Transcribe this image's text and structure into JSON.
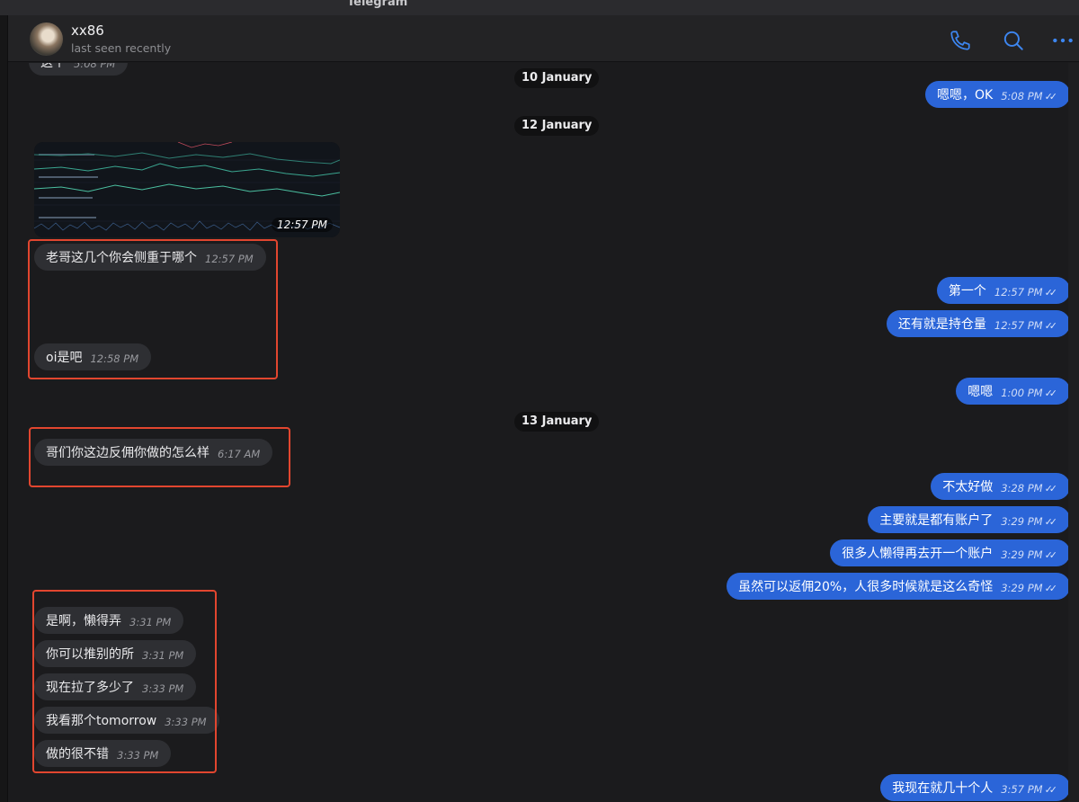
{
  "window": {
    "title": "Telegram"
  },
  "header": {
    "contact_name": "xx86",
    "contact_status": "last seen recently",
    "icons": [
      "phone-icon",
      "search-icon",
      "more-icon"
    ]
  },
  "chat": {
    "dates": [
      "10 January",
      "12 January",
      "13 January"
    ],
    "image_message": {
      "time": "12:57 PM",
      "content": "chart-thumbnail"
    },
    "top_clipped": {
      "text": "这个",
      "time": "5:08 PM"
    },
    "incoming": [
      {
        "text": "老哥这几个你会侧重于哪个",
        "time": "12:57 PM"
      },
      {
        "text": "oi是吧",
        "time": "12:58 PM"
      },
      {
        "text": "哥们你这边反佣你做的怎么样",
        "time": "6:17 AM"
      },
      {
        "text": "是啊，懒得弄",
        "time": "3:31 PM"
      },
      {
        "text": "你可以推别的所",
        "time": "3:31 PM"
      },
      {
        "text": "现在拉了多少了",
        "time": "3:33 PM"
      },
      {
        "text": "我看那个tomorrow",
        "time": "3:33 PM"
      },
      {
        "text": "做的很不错",
        "time": "3:33 PM"
      }
    ],
    "outgoing": [
      {
        "text": "嗯嗯，OK",
        "time": "5:08 PM"
      },
      {
        "text": "第一个",
        "time": "12:57 PM"
      },
      {
        "text": "还有就是持仓量",
        "time": "12:57 PM"
      },
      {
        "text": "嗯嗯",
        "time": "1:00 PM"
      },
      {
        "text": "不太好做",
        "time": "3:28 PM"
      },
      {
        "text": "主要就是都有账户了",
        "time": "3:29 PM"
      },
      {
        "text": "很多人懒得再去开一个账户",
        "time": "3:29 PM"
      },
      {
        "text": "虽然可以返佣20%，人很多时候就是这么奇怪",
        "time": "3:29 PM"
      },
      {
        "text": "我现在就几十个人",
        "time": "3:57 PM"
      }
    ],
    "read_check": "✓✓"
  },
  "colors": {
    "background": "#1b1b1d",
    "outgoing_bubble": "#2b65d8",
    "incoming_bubble": "#2e2f33",
    "accent_icon": "#3d86f0",
    "highlight_box": "#e2462f"
  }
}
